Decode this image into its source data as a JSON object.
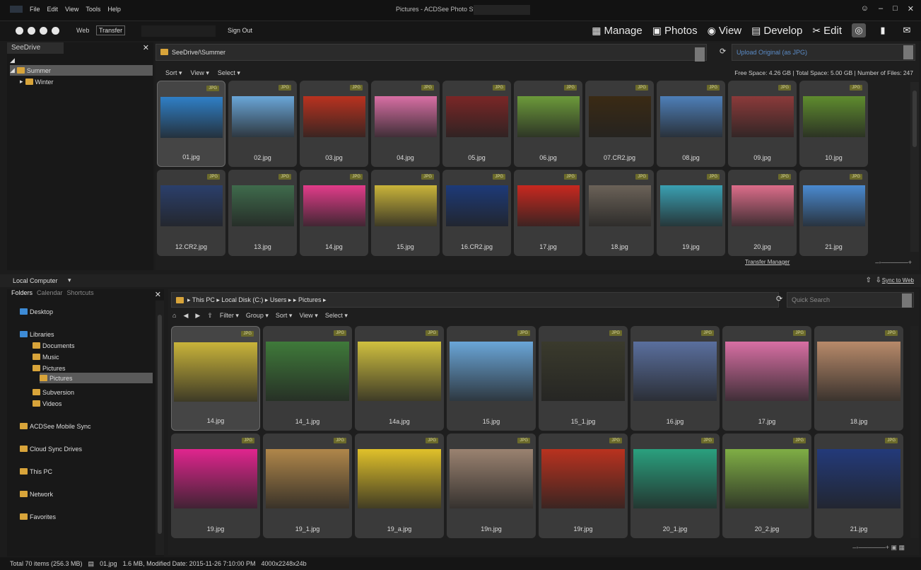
{
  "titlebar": {
    "menu": [
      "File",
      "Edit",
      "View",
      "Tools",
      "Help"
    ],
    "title": "Pictures - ACDSee Photo Studio",
    "window_controls": [
      "–",
      "□",
      "✕"
    ]
  },
  "toolbar": {
    "web": "Web",
    "transfer": "Transfer",
    "signout": "Sign Out",
    "modes": [
      {
        "label": "Manage",
        "icon": "grid-icon"
      },
      {
        "label": "Photos",
        "icon": "photos-icon"
      },
      {
        "label": "View",
        "icon": "eye-icon"
      },
      {
        "label": "Develop",
        "icon": "develop-icon"
      },
      {
        "label": "Edit",
        "icon": "edit-icon"
      }
    ],
    "extra_icons": [
      "365-icon",
      "histogram-icon",
      "notifications-icon"
    ]
  },
  "seedrive": {
    "tab": "SeeDrive",
    "items": [
      {
        "label": "Summer",
        "selected": true
      },
      {
        "label": "Winter",
        "selected": false
      }
    ]
  },
  "top_browser": {
    "path": "SeeDrive/\\Summer",
    "upload": "Upload Original (as JPG)",
    "sortbar": [
      "Sort ▾",
      "View ▾",
      "Select ▾"
    ],
    "space": "Free Space: 4.26 GB  |  Total Space: 5.00 GB  |  Number of Files: 247",
    "files": [
      {
        "name": "01.jpg",
        "badge": "JPG",
        "color": "#2f7fc6"
      },
      {
        "name": "02.jpg",
        "badge": "JPG",
        "color": "#6aa6d8"
      },
      {
        "name": "03.jpg",
        "badge": "JPG",
        "color": "#b9321f"
      },
      {
        "name": "04.jpg",
        "badge": "JPG",
        "color": "#d86fa4"
      },
      {
        "name": "05.jpg",
        "badge": "JPG",
        "color": "#7a2626"
      },
      {
        "name": "06.jpg",
        "badge": "JPG",
        "color": "#6c9a3a"
      },
      {
        "name": "07.CR2.jpg",
        "badge": "JPG",
        "color": "#3a2a14"
      },
      {
        "name": "08.jpg",
        "badge": "JPG",
        "color": "#4e7fb8"
      },
      {
        "name": "09.jpg",
        "badge": "JPG",
        "color": "#8b3a3a"
      },
      {
        "name": "10.jpg",
        "badge": "JPG",
        "color": "#5f8c2e"
      },
      {
        "name": "12.CR2.jpg",
        "badge": "JPG",
        "color": "#2b3f6b"
      },
      {
        "name": "13.jpg",
        "badge": "JPG",
        "color": "#3f6b4c"
      },
      {
        "name": "14.jpg",
        "badge": "JPG",
        "color": "#e23c8a"
      },
      {
        "name": "15.jpg",
        "badge": "JPG",
        "color": "#c9b43a"
      },
      {
        "name": "16.CR2.jpg",
        "badge": "JPG",
        "color": "#1d3a78"
      },
      {
        "name": "17.jpg",
        "badge": "JPG",
        "color": "#c8281f"
      },
      {
        "name": "18.jpg",
        "badge": "JPG",
        "color": "#6b6258"
      },
      {
        "name": "19.jpg",
        "badge": "JPG",
        "color": "#3aa0b2"
      },
      {
        "name": "20.jpg",
        "badge": "JPG",
        "color": "#dc6d8a"
      },
      {
        "name": "21.jpg",
        "badge": "JPG",
        "color": "#4a8ad0"
      }
    ],
    "transfer_manager": "Transfer Manager"
  },
  "local": {
    "title": "Local Computer",
    "sync": "Sync to Web"
  },
  "folders": {
    "tabs": [
      "Folders",
      "Calendar",
      "Shortcuts"
    ],
    "items": [
      {
        "label": "Desktop"
      },
      {
        "label": "Libraries"
      },
      {
        "label": "Documents"
      },
      {
        "label": "Music"
      },
      {
        "label": "Pictures"
      },
      {
        "label": "Pictures",
        "selected": true
      },
      {
        "label": "Subversion"
      },
      {
        "label": "Videos"
      },
      {
        "label": "ACDSee Mobile Sync"
      },
      {
        "label": "Cloud Sync Drives"
      },
      {
        "label": "This PC"
      },
      {
        "label": "Network"
      },
      {
        "label": "Favorites"
      }
    ]
  },
  "bottom_browser": {
    "path": "▸ This PC ▸ Local Disk (C:) ▸ Users ▸           ▸ Pictures ▸",
    "quick_search": "Quick Search",
    "filterbar": [
      "Filter ▾",
      "Group ▾",
      "Sort ▾",
      "View ▾",
      "Select ▾"
    ],
    "files": [
      {
        "name": "14.jpg",
        "badge": "JPG",
        "color": "#c9b43a"
      },
      {
        "name": "14_1.jpg",
        "badge": "JPG",
        "color": "#3f7a3a"
      },
      {
        "name": "14a.jpg",
        "badge": "JPG",
        "color": "#d0c03f"
      },
      {
        "name": "15.jpg",
        "badge": "JPG",
        "color": "#6aa6d8"
      },
      {
        "name": "15_1.jpg",
        "badge": "JPG",
        "color": "#3a3a2c"
      },
      {
        "name": "16.jpg",
        "badge": "JPG",
        "color": "#5a6f9e"
      },
      {
        "name": "17.jpg",
        "badge": "JPG",
        "color": "#d86fa4"
      },
      {
        "name": "18.jpg",
        "badge": "JPG",
        "color": "#b88a6a"
      },
      {
        "name": "19.jpg",
        "badge": "JPG",
        "color": "#e0258e"
      },
      {
        "name": "19_1.jpg",
        "badge": "JPG",
        "color": "#b0874a"
      },
      {
        "name": "19_a.jpg",
        "badge": "JPG",
        "color": "#e0c12a"
      },
      {
        "name": "19n.jpg",
        "badge": "JPG",
        "color": "#9a8270"
      },
      {
        "name": "19r.jpg",
        "badge": "JPG",
        "color": "#b9321f"
      },
      {
        "name": "20_1.jpg",
        "badge": "JPG",
        "color": "#2aa07e"
      },
      {
        "name": "20_2.jpg",
        "badge": "JPG",
        "color": "#7fae45"
      },
      {
        "name": "21.jpg",
        "badge": "JPG",
        "color": "#233a7a"
      }
    ]
  },
  "status": {
    "items": [
      "Total 70 items  (256.3 MB)",
      "01.jpg",
      "1.6 MB, Modified Date: 2015-11-26 7:10:00 PM",
      "4000x2248x24b"
    ]
  }
}
